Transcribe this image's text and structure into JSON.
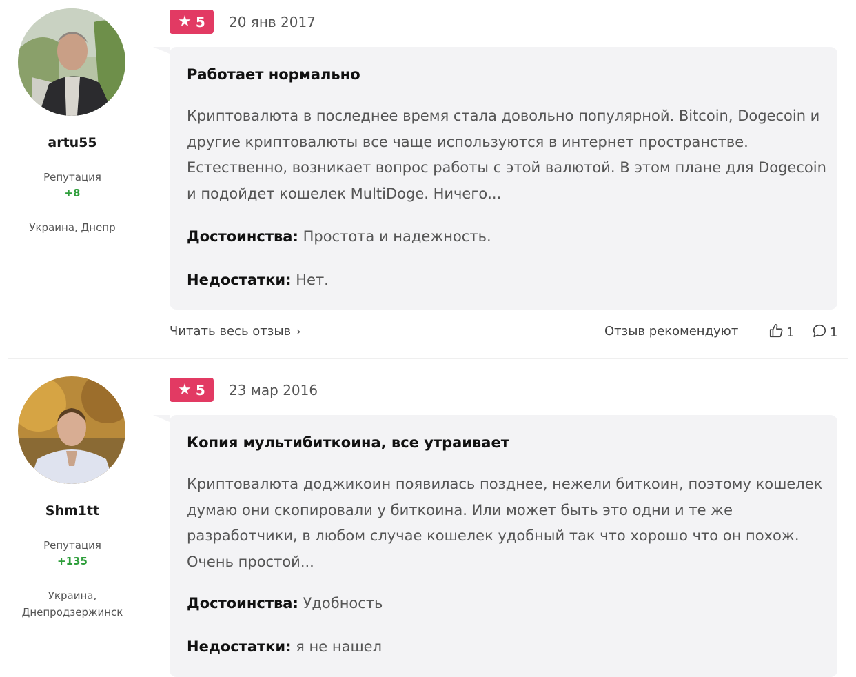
{
  "reviews": [
    {
      "author": {
        "username": "artu55",
        "reputation_label": "Репутация",
        "reputation_value": "+8",
        "location": "Украина, Днепр"
      },
      "rating": "5",
      "date": "20 янв 2017",
      "title": "Работает нормально",
      "text": "Криптовалюта в последнее время стала довольно популярной. Bitcoin, Dogecoin и другие криптовалюты все чаще используются в интернет пространстве. Естественно, возникает вопрос работы с этой валютой. В этом плане для Dogecoin и подойдет кошелек MultiDoge. Ничего...",
      "pros_label": "Достоинства:",
      "pros": "Простота и надежность.",
      "cons_label": "Недостатки:",
      "cons": "Нет.",
      "read_more": "Читать весь отзыв",
      "recommend_label": "Отзыв рекомендуют",
      "likes": "1",
      "comments": "1"
    },
    {
      "author": {
        "username": "Shm1tt",
        "reputation_label": "Репутация",
        "reputation_value": "+135",
        "location_line1": "Украина,",
        "location_line2": "Днепродзержинск"
      },
      "rating": "5",
      "date": "23 мар 2016",
      "title": "Копия мультибиткоина, все утраивает",
      "text": "Криптовалюта доджикоин появилась позднее, нежели биткоин, поэтому кошелек думаю они скопировали у биткоина. Или может быть это одни и те же разработчики, в любом случае кошелек удобный так что хорошо что он похож. Очень простой...",
      "pros_label": "Достоинства:",
      "pros": "Удобность",
      "cons_label": "Недостатки:",
      "cons": "я не нашел"
    }
  ],
  "colors": {
    "badge": "#e23a63",
    "reputation": "#2e9e3b",
    "card_bg": "#f3f3f5"
  },
  "icons": [
    "star-icon",
    "thumbs-up-icon",
    "comment-icon",
    "chevron-right-icon"
  ]
}
